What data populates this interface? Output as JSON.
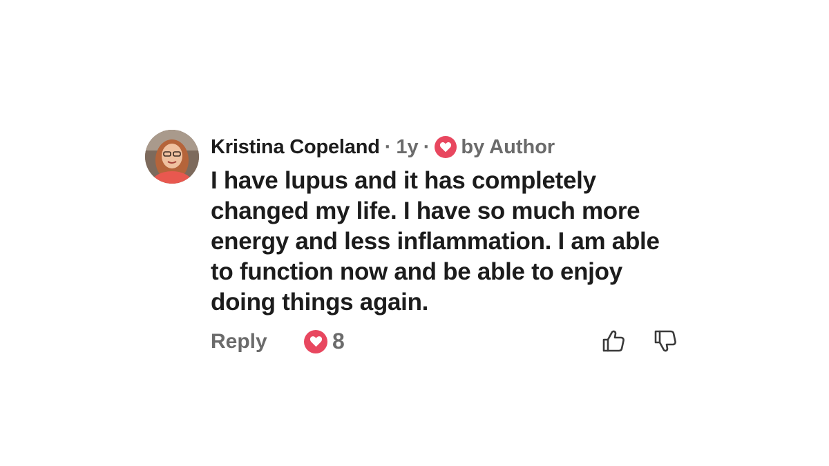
{
  "comment": {
    "author": "Kristina Copeland",
    "separator": "·",
    "age": "1y",
    "loved_by": "by Author",
    "text": "I have lupus and it has completely changed my life. I have so much more energy and less inflammation. I am able to function now and be able to enjoy doing things again.",
    "reply_label": "Reply",
    "like_count": "8"
  },
  "icons": {
    "avatar": "profile-photo",
    "author_heart": "heart-icon",
    "like_heart": "heart-icon",
    "thumbs_up": "thumbs-up-icon",
    "thumbs_down": "thumbs-down-icon"
  },
  "colors": {
    "heart_badge": "#e8475f",
    "text_primary": "#1c1c1c",
    "text_secondary": "#6b6b6b"
  }
}
